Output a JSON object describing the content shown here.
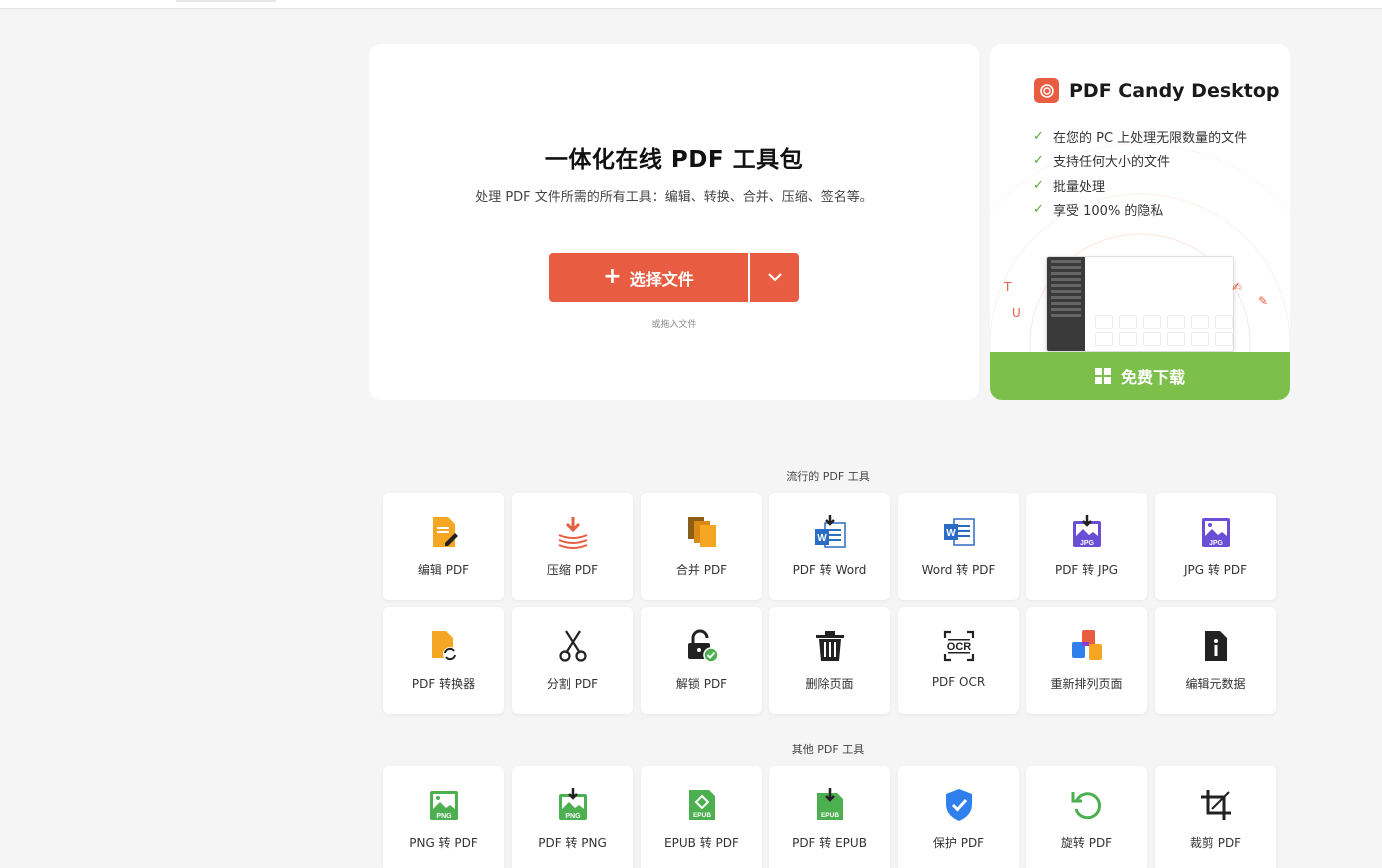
{
  "hero": {
    "title": "一体化在线 PDF 工具包",
    "subtitle": "处理 PDF 文件所需的所有工具：编辑、转换、合并、压缩、签名等。",
    "choose_label": "选择文件",
    "drop_hint": "或拖入文件"
  },
  "promo": {
    "brand_name": "PDF Candy Desktop",
    "features": [
      "在您的 PC 上处理无限数量的文件",
      "支持任何大小的文件",
      "批量处理",
      "享受 100% 的隐私"
    ],
    "download_label": "免费下载"
  },
  "popular": {
    "title": "流行的 PDF 工具",
    "tools": [
      {
        "label": "编辑 PDF",
        "icon": "edit-pdf-icon"
      },
      {
        "label": "压缩 PDF",
        "icon": "compress-pdf-icon"
      },
      {
        "label": "合并 PDF",
        "icon": "merge-pdf-icon"
      },
      {
        "label": "PDF 转 Word",
        "icon": "pdf-to-word-icon"
      },
      {
        "label": "Word 转 PDF",
        "icon": "word-to-pdf-icon"
      },
      {
        "label": "PDF 转 JPG",
        "icon": "pdf-to-jpg-icon"
      },
      {
        "label": "JPG 转 PDF",
        "icon": "jpg-to-pdf-icon"
      },
      {
        "label": "PDF 转换器",
        "icon": "pdf-converter-icon"
      },
      {
        "label": "分割 PDF",
        "icon": "scissors-icon"
      },
      {
        "label": "解锁 PDF",
        "icon": "unlock-icon"
      },
      {
        "label": "删除页面",
        "icon": "trash-icon"
      },
      {
        "label": "PDF OCR",
        "icon": "ocr-icon"
      },
      {
        "label": "重新排列页面",
        "icon": "rearrange-icon"
      },
      {
        "label": "编辑元数据",
        "icon": "metadata-icon"
      }
    ]
  },
  "other": {
    "title": "其他 PDF 工具",
    "tools": [
      {
        "label": "PNG 转 PDF",
        "icon": "png-to-pdf-icon"
      },
      {
        "label": "PDF 转 PNG",
        "icon": "pdf-to-png-icon"
      },
      {
        "label": "EPUB 转 PDF",
        "icon": "epub-to-pdf-icon"
      },
      {
        "label": "PDF 转 EPUB",
        "icon": "pdf-to-epub-icon"
      },
      {
        "label": "保护 PDF",
        "icon": "shield-icon"
      },
      {
        "label": "旋转 PDF",
        "icon": "rotate-icon"
      },
      {
        "label": "裁剪 PDF",
        "icon": "crop-icon"
      }
    ]
  },
  "colors": {
    "accent": "#e85d42",
    "download_green": "#7cc04b",
    "background": "#f5f5f5"
  }
}
